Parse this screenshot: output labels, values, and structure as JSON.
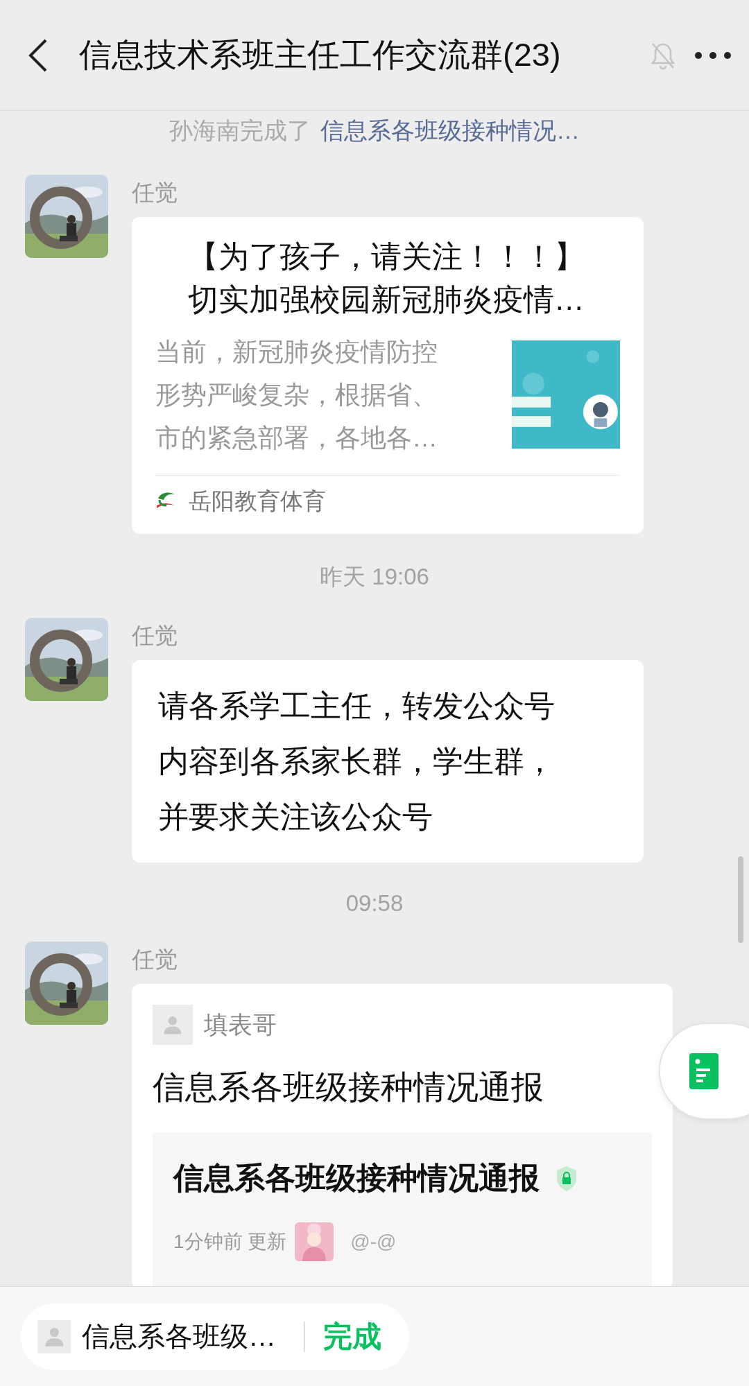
{
  "header": {
    "title": "信息技术系班主任工作交流群(23)",
    "muted": true
  },
  "system_notice": {
    "actor": "孙海南完成了",
    "link": "信息系各班级接种情况…"
  },
  "messages": [
    {
      "kind": "article",
      "sender": "任觉",
      "title": "【为了孩子，请关注！！！】切实加强校园新冠肺炎疫情…",
      "summary": "当前，新冠肺炎疫情防控形势严峻复杂，根据省、市的紧急部署，各地各…",
      "source": "岳阳教育体育"
    },
    {
      "kind": "time",
      "text": "昨天 19:06"
    },
    {
      "kind": "text",
      "sender": "任觉",
      "text": "请各系学工主任，转发公众号内容到各系家长群，学生群，并要求关注该公众号"
    },
    {
      "kind": "time",
      "text": "09:58"
    },
    {
      "kind": "form",
      "sender": "任觉",
      "author": "填表哥",
      "title": "信息系各班级接种情况通报",
      "card_title": "信息系各班级接种情况通报",
      "updated": "1分钟前 更新",
      "user": "@-@"
    }
  ],
  "bottom_bar": {
    "quote": "信息系各班级…",
    "button": "完成"
  }
}
